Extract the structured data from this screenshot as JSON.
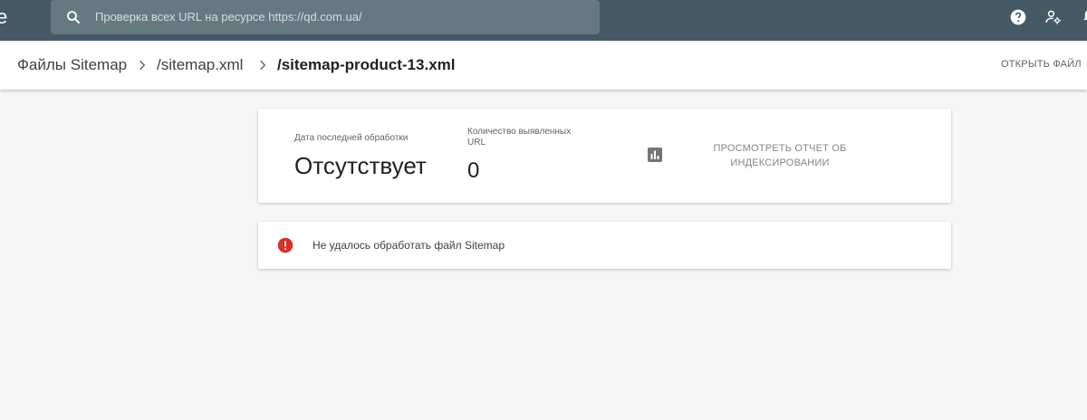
{
  "search": {
    "placeholder": "Проверка всех URL на ресурсе https://qd.com.ua/"
  },
  "breadcrumb": {
    "items": [
      "Файлы Sitemap",
      "/sitemap.xml",
      "/sitemap-product-13.xml"
    ]
  },
  "header_action": "ОТКРЫТЬ ФАЙЛ",
  "summary": {
    "last_processed_label": "Дата последней обработки",
    "last_processed_value": "Отсутствует",
    "urls_found_label_line1": "Количество выявленных",
    "urls_found_label_line2": "URL",
    "urls_found_value": "0",
    "report_link_line1": "ПРОСМОТРЕТЬ ОТЧЕТ ОБ",
    "report_link_line2": "ИНДЕКСИРОВАНИИ"
  },
  "error": {
    "message": "Не удалось обработать файл Sitemap"
  },
  "icons": {
    "search": "search-icon",
    "help": "help-icon",
    "admin": "admin-settings-icon",
    "notifications": "notifications-icon",
    "report": "bar-chart-icon",
    "error": "error-icon"
  },
  "colors": {
    "topbar": "#455a64",
    "search_bg": "#667981",
    "error": "#d93025",
    "page_bg": "#f6f6f6"
  }
}
